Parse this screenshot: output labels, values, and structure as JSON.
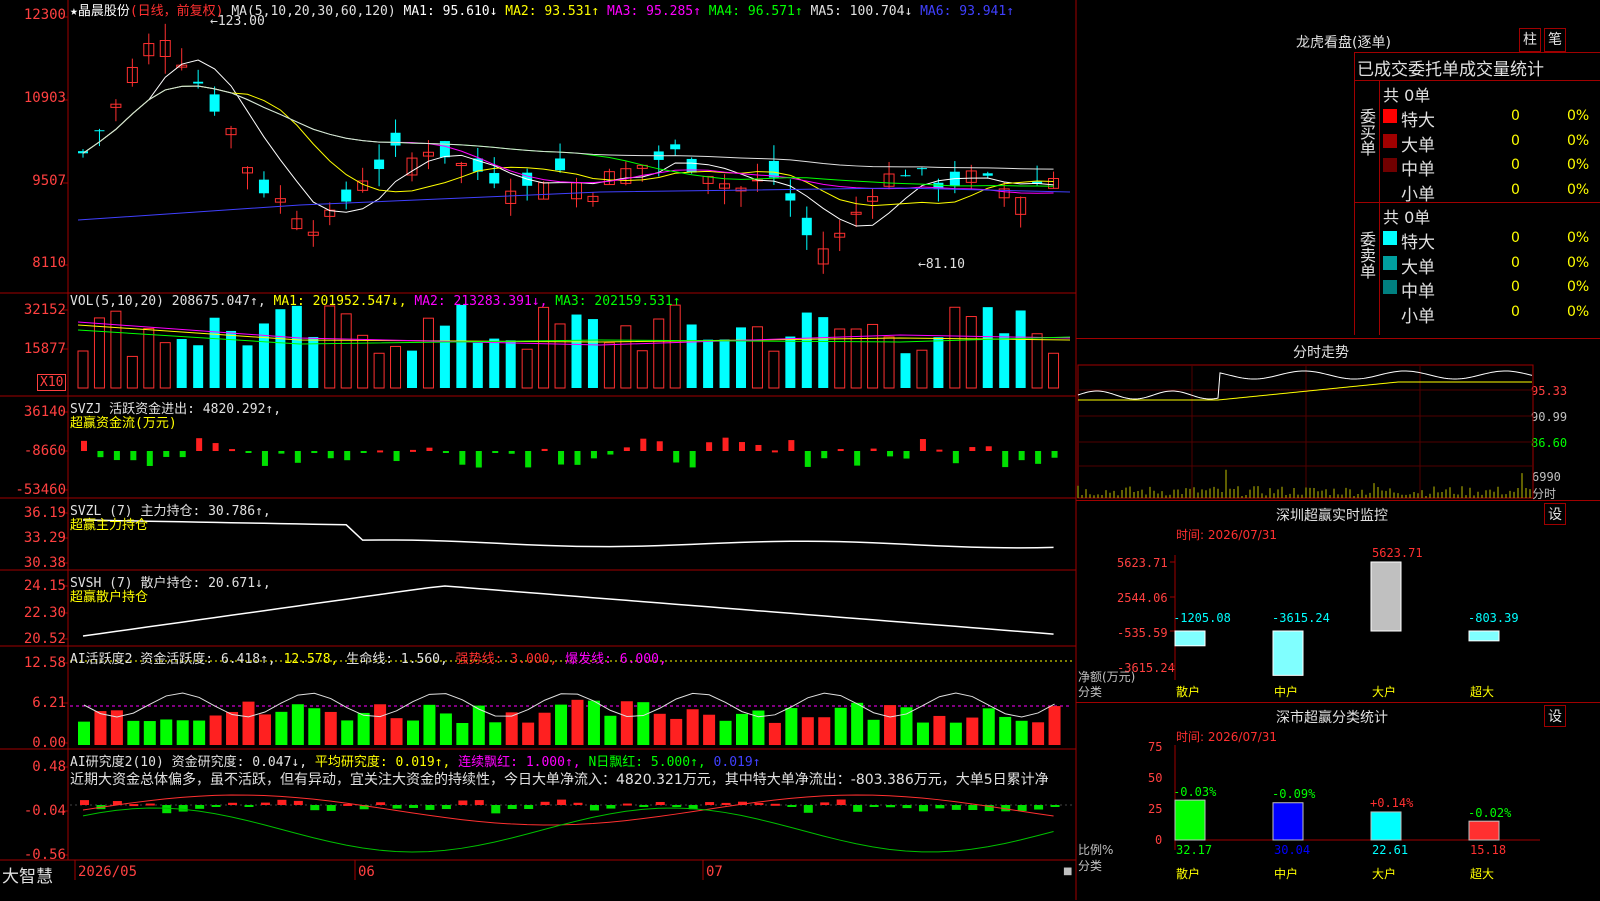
{
  "main_chart": {
    "star": "★",
    "stock_name": "晶晨股份",
    "period_label": "(日线，前复权)",
    "ma_line": [
      {
        "label": "MA(5,10,20,30,60,120)",
        "color": "#e0e0e0"
      },
      {
        "label": "MA1: 95.610↓",
        "color": "#ffffff"
      },
      {
        "label": "MA2: 93.531↑",
        "color": "#ffff00"
      },
      {
        "label": "MA3: 95.285↑",
        "color": "#ff00ff"
      },
      {
        "label": "MA4: 96.571↑",
        "color": "#00ff00"
      },
      {
        "label": "MA5: 100.704↓",
        "color": "#e0e0e0"
      },
      {
        "label": "MA6: 93.941↑",
        "color": "#4040ff"
      }
    ],
    "y_ticks": [
      "12300",
      "10903",
      "9507",
      "8110"
    ],
    "high_label": "123.00",
    "low_label": "81.10"
  },
  "vol_panel": {
    "title_parts": [
      {
        "text": "VOL(5,10,20)  208675.047↑,",
        "color": "#e0e0e0"
      },
      {
        "text": " MA1: 201952.547↓,",
        "color": "#ffff00"
      },
      {
        "text": " MA2: 213283.391↓,",
        "color": "#ff00ff"
      },
      {
        "text": " MA3: 202159.531↑",
        "color": "#00ff00"
      }
    ],
    "y_ticks": [
      "32152",
      "15877"
    ],
    "unit": "X10"
  },
  "svzj_panel": {
    "title": "SVZJ  活跃资金进出: 4820.292↑,",
    "subtitle": "超赢资金流(万元)",
    "y_ticks": [
      "36140",
      "-8660",
      "-53460"
    ]
  },
  "svzl_panel": {
    "title": "SVZL (7) 主力持仓: 30.786↑,",
    "subtitle": "超赢主力持仓",
    "y_ticks": [
      "36.19",
      "33.29",
      "30.38"
    ]
  },
  "svsh_panel": {
    "title": "SVSH (7) 散户持仓: 20.671↓,",
    "subtitle": "超赢散户持仓",
    "y_ticks": [
      "24.15",
      "22.30",
      "20.52"
    ]
  },
  "ai_active_panel": {
    "title_parts": [
      {
        "text": "AI活跃度2 资金活跃度: 6.418↑,",
        "color": "#e0e0e0"
      },
      {
        "text": " 12.578,",
        "color": "#ffff00"
      },
      {
        "text": " 生命线: 1.560,",
        "color": "#e0e0e0"
      },
      {
        "text": " 强势线: 3.000,",
        "color": "#ff3030"
      },
      {
        "text": " 爆发线: 6.000,",
        "color": "#ff00ff"
      }
    ],
    "y_ticks": [
      "12.58",
      "6.21",
      "0.00"
    ]
  },
  "ai_research_panel": {
    "title_parts": [
      {
        "text": "AI研究度2(10) 资金研究度: 0.047↓,",
        "color": "#e0e0e0"
      },
      {
        "text": " 平均研究度: 0.019↑,",
        "color": "#ffff00"
      },
      {
        "text": " 连续飘红: 1.000↑,",
        "color": "#ff00ff"
      },
      {
        "text": " N日飘红: 5.000↑,",
        "color": "#00ff00"
      },
      {
        "text": " 0.019↑",
        "color": "#4040ff"
      }
    ],
    "comment": "近期大资金总体偏多，虽不活跃，但有异动，宜关注大资金的持续性，今日大单净流入：4820.321万元，其中特大单净流出：-803.386万元，大单5日累计净",
    "y_ticks": [
      "0.48",
      "-0.04",
      "-0.56"
    ]
  },
  "footer": {
    "brand": "大智慧",
    "dates": [
      "2026/05",
      "06",
      "07"
    ]
  },
  "longhu": {
    "title": "龙虎看盘(逐单)",
    "btn_bar": "柱",
    "btn_bi": "笔",
    "stat_title": "已成交委托单成交量统计",
    "buy_label": "委买单",
    "sell_label": "委卖单",
    "buy_total": "共 0单",
    "sell_total": "共 0单",
    "buy_rows": [
      {
        "name": "特大",
        "count": "0",
        "pct": "0%",
        "color": "#ff0000"
      },
      {
        "name": "大单",
        "count": "0",
        "pct": "0%",
        "color": "#a00000"
      },
      {
        "name": "中单",
        "count": "0",
        "pct": "0%",
        "color": "#700000"
      },
      {
        "name": "小单",
        "count": "0",
        "pct": "0%",
        "color": "#000000"
      }
    ],
    "sell_rows": [
      {
        "name": "特大",
        "count": "0",
        "pct": "0%",
        "color": "#00ffff"
      },
      {
        "name": "大单",
        "count": "0",
        "pct": "0%",
        "color": "#00a0a0"
      },
      {
        "name": "中单",
        "count": "0",
        "pct": "0%",
        "color": "#008080"
      },
      {
        "name": "小单",
        "count": "0",
        "pct": "0%",
        "color": "#000000"
      }
    ]
  },
  "intraday": {
    "title": "分时走势",
    "price_ticks": [
      "95.33",
      "90.99",
      "86.60"
    ],
    "vol_tick": "6990",
    "vol_label": "分时"
  },
  "sz_monitor": {
    "title": "深圳超赢实时监控",
    "btn": "设",
    "time": "时间: 2026/07/31",
    "y_ticks": [
      "5623.71",
      "2544.06",
      "-535.59",
      "-3615.24"
    ],
    "bar_values": [
      "-1205.08",
      "-3615.24",
      "5623.71",
      "-803.39"
    ],
    "values_num": [
      -1205.08,
      -3615.24,
      5623.71,
      -803.39
    ],
    "ylabel": "净额(万元)",
    "xlabel": "分类",
    "categories": [
      "散户",
      "中户",
      "大户",
      "超大"
    ]
  },
  "sz_classify": {
    "title": "深市超赢分类统计",
    "btn": "设",
    "time": "时间: 2026/07/31",
    "y_ticks": [
      "75",
      "50",
      "25",
      "0"
    ],
    "top_labels": [
      "-0.03%",
      "-0.09%",
      "+0.14%",
      "-0.02%"
    ],
    "bottom_labels": [
      "32.17",
      "30.04",
      "22.61",
      "15.18"
    ],
    "values_num": [
      32.17,
      30.04,
      22.61,
      15.18
    ],
    "ylabel": "比例%",
    "xlabel": "分类",
    "categories": [
      "散户",
      "中户",
      "大户",
      "超大"
    ]
  }
}
